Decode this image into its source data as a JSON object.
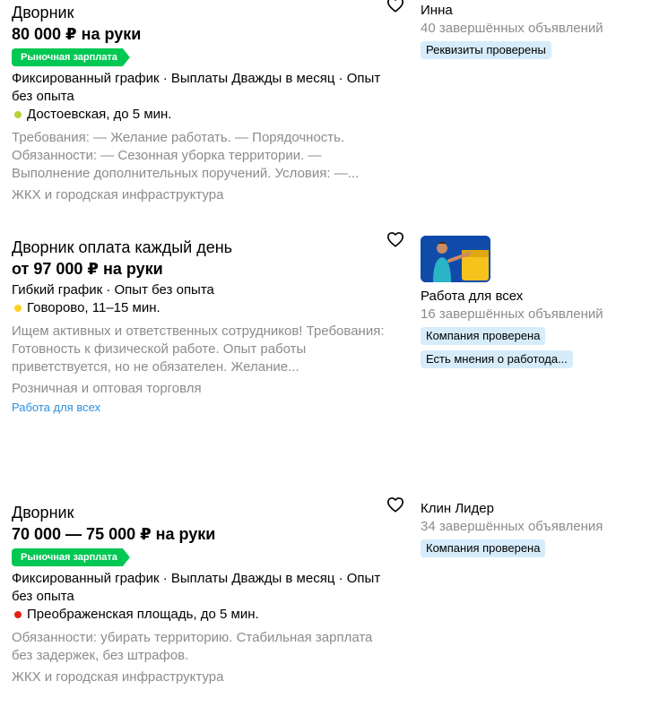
{
  "cards": [
    {
      "title": "Дворник",
      "price": "80 000 ₽ на руки",
      "badge": "Рыночная зарплата",
      "params": "Фиксированный график · Выплаты Дважды в месяц · Опыт без опыта",
      "metro": "Достоевская, до 5 мин.",
      "metro_color": "#b5d335",
      "description": "Требования: — Желание работать. — Порядочность. Обязанности: — Сезонная уборка территории. — Выполнение дополнительных поручений. Условия: —...",
      "industry": "ЖКХ и городская инфраструктура",
      "seller": {
        "name": "Инна",
        "count": "40 завершённых объявлений",
        "pills": [
          "Реквизиты проверены"
        ]
      }
    },
    {
      "title": "Дворник оплата каждый день",
      "price": "от 97 000 ₽ на руки",
      "params": "Гибкий график · Опыт без опыта",
      "metro": "Говорово, 11–15 мин.",
      "metro_color": "#ffd21f",
      "description": "Ищем активных и ответственных сотрудников! Требования: Готовность к физической работе. Опыт работы приветствуется, но не обязателен. Желание...",
      "industry": "Розничная и оптовая торговля",
      "company_link": "Работа для всех",
      "seller": {
        "name": "Работа для всех",
        "count": "16 завершённых объявлений",
        "pills": [
          "Компания проверена",
          "Есть мнения о работода..."
        ]
      }
    },
    {
      "title": "Дворник",
      "price": "70 000 — 75 000 ₽ на руки",
      "badge": "Рыночная зарплата",
      "params": "Фиксированный график · Выплаты Дважды в месяц · Опыт без опыта",
      "metro": "Преображенская площадь, до 5 мин.",
      "metro_color": "#e42313",
      "description": "Обязанности: убирать территорию. Стабильная зарплата без задержек, без штрафов.",
      "industry": "ЖКХ и городская инфраструктура",
      "seller": {
        "name": "Клин Лидер",
        "count": "34 завершённых объявления",
        "pills": [
          "Компания проверена"
        ]
      }
    }
  ],
  "icons": {
    "favorite": "heart-outline-icon"
  }
}
